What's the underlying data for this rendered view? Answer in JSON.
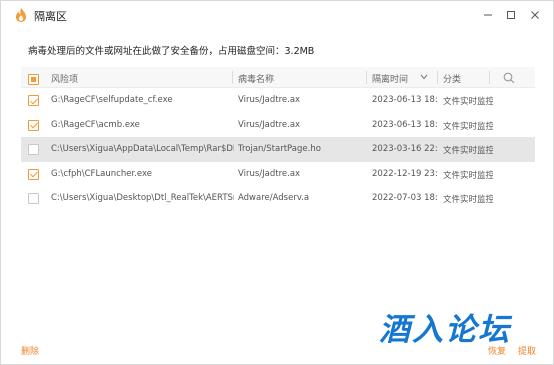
{
  "window": {
    "title": "隔离区"
  },
  "info_text": "病毒处理后的文件或网址在此做了安全备份，占用磁盘空间：3.2MB",
  "table": {
    "headers": {
      "item": "风险项",
      "virus": "病毒名称",
      "time": "隔离时间",
      "category": "分类"
    },
    "rows": [
      {
        "checked": true,
        "selected": false,
        "path": "G:\\RageCF\\selfupdate_cf.exe",
        "virus": "Virus/Jadtre.ax",
        "time": "2023-06-13 18:1",
        "category": "文件实时监控"
      },
      {
        "checked": true,
        "selected": false,
        "path": "G:\\RageCF\\acmb.exe",
        "virus": "Virus/Jadtre.ax",
        "time": "2023-06-13 18:1",
        "category": "文件实时监控"
      },
      {
        "checked": false,
        "selected": true,
        "path": "C:\\Users\\Xigua\\AppData\\Local\\Temp\\Rar$DRa",
        "virus": "Trojan/StartPage.ho",
        "time": "2023-03-16 22:4",
        "category": "文件实时监控"
      },
      {
        "checked": true,
        "selected": false,
        "path": "G:\\cfph\\CFLauncher.exe",
        "virus": "Virus/Jadtre.ax",
        "time": "2022-12-19 23:5",
        "category": "文件实时监控"
      },
      {
        "checked": false,
        "selected": false,
        "path": "C:\\Users\\Xigua\\Desktop\\Dtl_RealTek\\AERTSrv",
        "virus": "Adware/Adserv.a",
        "time": "2022-07-03 18:2",
        "category": "文件实时监控"
      }
    ]
  },
  "footer": {
    "delete": "删除",
    "restore": "恢复",
    "extract": "提取"
  },
  "watermark": "酒入论坛",
  "colors": {
    "accent": "#f29b38",
    "link": "#f0832a",
    "watermark": "#1677d2"
  },
  "icons": {
    "logo": "flame-logo-icon",
    "minimize": "minimize-icon",
    "maximize": "maximize-icon",
    "close": "close-icon",
    "sort": "chevron-down-icon",
    "search": "search-icon"
  }
}
